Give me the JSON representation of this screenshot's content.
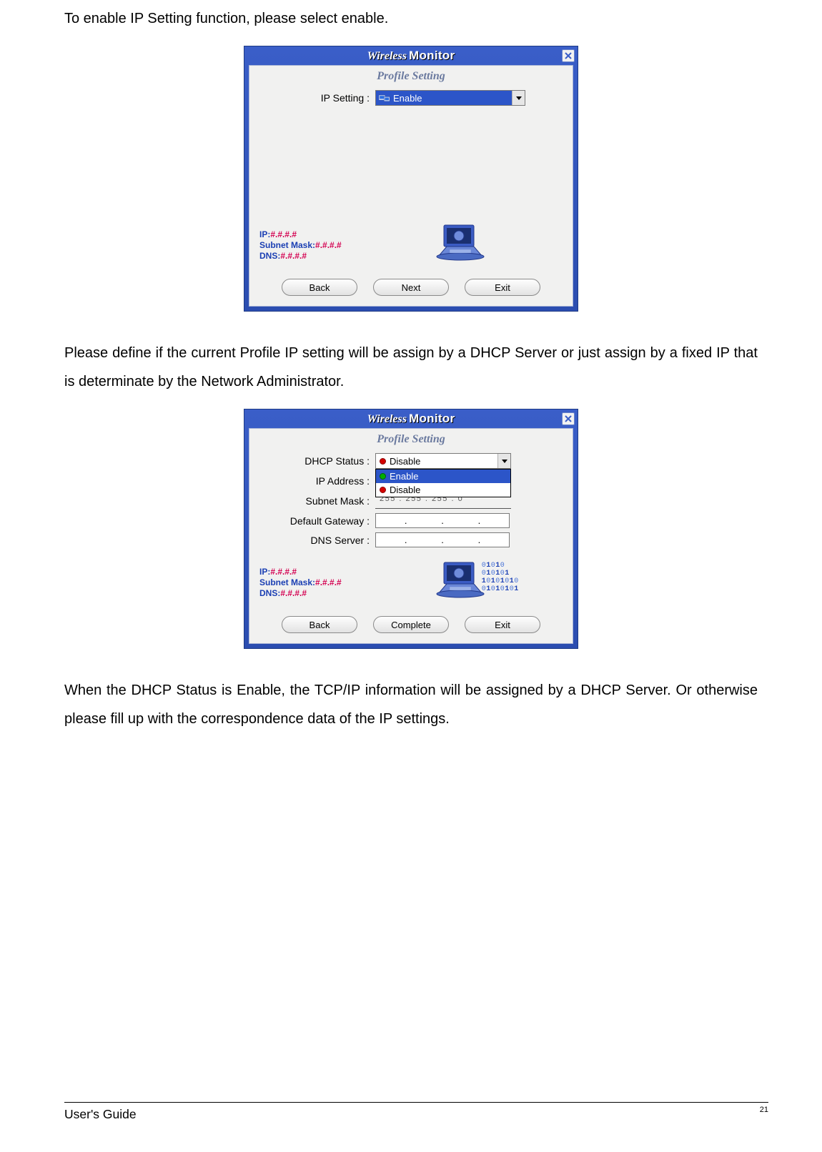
{
  "paragraphs": {
    "p1": "To enable IP Setting function, please select enable.",
    "p2": "Please define if the current Profile IP setting will be assign by a DHCP Server or just assign by a fixed IP that is determinate by the Network Administrator.",
    "p3": "When the DHCP Status is Enable, the TCP/IP information will be assigned by a DHCP Server. Or otherwise please fill up with the correspondence data of the IP settings."
  },
  "app": {
    "title_a": "Wireless",
    "title_b": "Monitor",
    "subtitle": "Profile Setting"
  },
  "dialog1": {
    "ip_setting_label": "IP Setting :",
    "ip_setting_value": "Enable",
    "buttons": {
      "back": "Back",
      "next": "Next",
      "exit": "Exit"
    }
  },
  "dialog2": {
    "dhcp_status_label": "DHCP Status :",
    "dhcp_status_value": "Disable",
    "dhcp_options": {
      "enable": "Enable",
      "disable": "Disable"
    },
    "ip_address_label": "IP Address :",
    "subnet_mask_label": "Subnet Mask :",
    "subnet_ghost": "255 . 255 . 255 .   0",
    "default_gateway_label": "Default Gateway :",
    "dns_server_label": "DNS Server :",
    "buttons": {
      "back": "Back",
      "complete": "Complete",
      "exit": "Exit"
    }
  },
  "ip_panel": {
    "ip_label": "IP:",
    "ip_val": "#.#.#.#",
    "mask_label": "Subnet Mask:",
    "mask_val": "#.#.#.#",
    "dns_label": "DNS:",
    "dns_val": "#.#.#.#"
  },
  "binary_lines": [
    "01010",
    "010101",
    "10101010",
    "01010101"
  ],
  "footer": {
    "guide": "User's Guide",
    "page": "21"
  }
}
